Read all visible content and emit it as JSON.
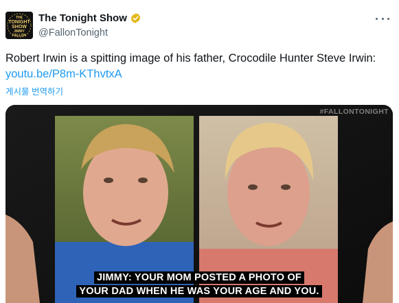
{
  "tweet": {
    "display_name": "The Tonight Show",
    "handle": "@FallonTonight",
    "text_before_link": "Robert Irwin is a spitting image of his father, Crocodile Hunter Steve Irwin: ",
    "link_text": "youtu.be/P8m-KThvtxA",
    "translate_label": "게시물 번역하기"
  },
  "icons": {
    "avatar": "tonight-show-logo",
    "verified": "verified-badge-icon",
    "more": "more-options-icon"
  },
  "avatar_logo_lines": [
    "THE",
    "TONIGHT",
    "SHOW",
    "JIMMY",
    "FALLON"
  ],
  "media": {
    "watermark": "#FALLONTONIGHT",
    "caption_line1": "JIMMY: YOUR MOM POSTED A PHOTO OF",
    "caption_line2": "YOUR DAD WHEN HE WAS YOUR AGE AND YOU."
  },
  "colors": {
    "link": "#1d9bf0",
    "verified": "#e2b719",
    "secondary_text": "#536471"
  }
}
